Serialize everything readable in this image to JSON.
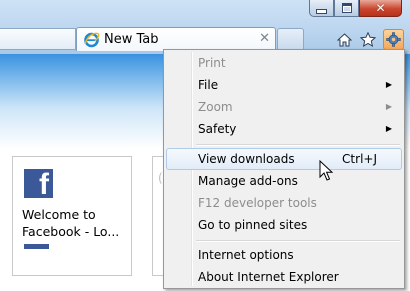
{
  "window": {
    "minimize_label": "",
    "maximize_label": "",
    "close_glyph": "✕"
  },
  "tabs": [
    {
      "title": "New Tab",
      "icon": "ie-icon",
      "close_glyph": "✕"
    }
  ],
  "command_bar": {
    "icons": [
      "home-icon",
      "favorites-star-icon",
      "tools-gear-icon"
    ]
  },
  "page": {
    "tiles": [
      {
        "icon": "facebook-icon",
        "logo_letter": "f",
        "title": "Welcome to Facebook - Lo..."
      }
    ],
    "tile2_glyph": "("
  },
  "tools_menu": {
    "items": [
      {
        "label": "Print",
        "disabled": true,
        "submenu": false
      },
      {
        "label": "File",
        "disabled": false,
        "submenu": true
      },
      {
        "label": "Zoom",
        "disabled": true,
        "submenu": true
      },
      {
        "label": "Safety",
        "disabled": false,
        "submenu": true
      },
      {
        "label": "View downloads",
        "shortcut": "Ctrl+J",
        "highlighted": true
      },
      {
        "label": "Manage add-ons",
        "disabled": false
      },
      {
        "label": "F12 developer tools",
        "disabled": true
      },
      {
        "label": "Go to pinned sites",
        "disabled": false
      },
      {
        "label": "Internet options",
        "disabled": false
      },
      {
        "label": "About Internet Explorer",
        "disabled": false
      }
    ],
    "submenu_arrow": "▶"
  },
  "colors": {
    "accent_orange": "#e8841c",
    "facebook_blue": "#3b5998",
    "menu_highlight_border": "#aecbec",
    "disabled_text": "#8d8d8d"
  }
}
